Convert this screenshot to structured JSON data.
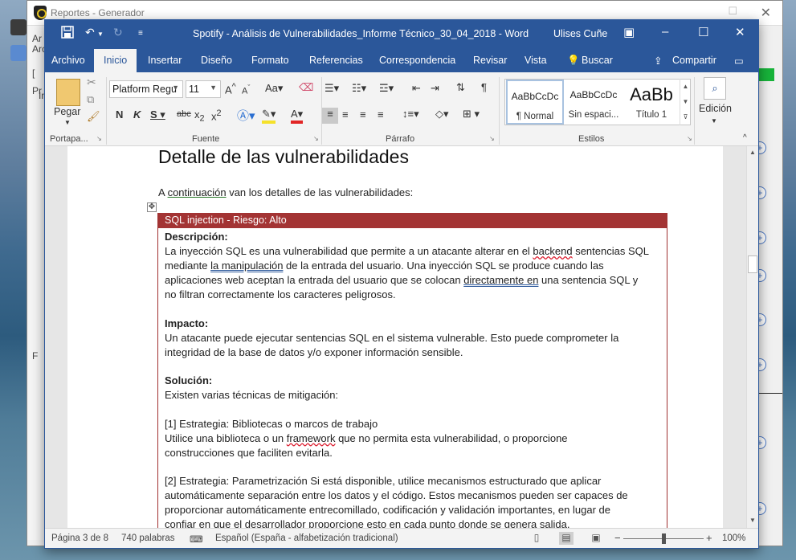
{
  "bg_window": {
    "title": "Reportes - Generador",
    "side_fragments": [
      "Ar",
      "Arc",
      "[",
      "Pr",
      "In",
      "F"
    ]
  },
  "word": {
    "title": "Spotify - Análisis de Vulnerabilidades_Informe Técnico_30_04_2018  -  Word",
    "user": "Ulises Cuñe",
    "tabs": [
      "Archivo",
      "Inicio",
      "Insertar",
      "Diseño",
      "Formato",
      "Referencias",
      "Correspondencia",
      "Revisar",
      "Vista",
      "Buscar",
      "Compartir"
    ],
    "ribbon": {
      "paste_label": "Pegar",
      "font_name": "Platform Regu",
      "font_size": "11",
      "styles": [
        {
          "preview": "AaBbCcDc",
          "name": "¶ Normal"
        },
        {
          "preview": "AaBbCcDc",
          "name": "Sin espaci..."
        },
        {
          "preview": "AaBb",
          "name": "Título 1"
        }
      ],
      "editing_label": "Edición",
      "groups": {
        "clipboard": "Portapa...",
        "font": "Fuente",
        "paragraph": "Párrafo",
        "styles": "Estilos"
      }
    },
    "document": {
      "heading": "Detalle de las vulnerabilidades",
      "intro": {
        "prefix": "A ",
        "link": "continuación",
        "suffix": " van los detalles de las vulnerabilidades:"
      },
      "table_header": "SQL injection - Riesgo: Alto",
      "description_label": "Descripción:",
      "description_lines": [
        {
          "a": "La inyección SQL es una vulnerabilidad que permite a un atacante alterar en el ",
          "b": "backend",
          "c": " sentencias SQL"
        },
        {
          "a": "mediante ",
          "b": "la  manipulación",
          "c": " de la entrada del usuario. Una inyección SQL se produce cuando las"
        },
        {
          "a": "aplicaciones web aceptan la entrada del usuario que se colocan ",
          "b": "directamente  en",
          "c": " una sentencia SQL y"
        },
        {
          "a": "no filtran correctamente los caracteres peligrosos.",
          "b": "",
          "c": ""
        }
      ],
      "impact_label": "Impacto:",
      "impact_lines": [
        "Un atacante puede ejecutar sentencias SQL en el sistema vulnerable. Esto puede comprometer la",
        "integridad de la base de datos y/o exponer información sensible."
      ],
      "solution_label": "Solución:",
      "solution_intro": "Existen varias técnicas de mitigación:",
      "strategy1_title": "[1] Estrategia: Bibliotecas o marcos de trabajo",
      "strategy1_line1": {
        "a": "Utilice una biblioteca o un ",
        "b": "framework",
        "c": " que no permita esta vulnerabilidad, o proporcione"
      },
      "strategy1_line2": "construcciones que faciliten evitarla.",
      "strategy2_lines": [
        "[2] Estrategia: Parametrización Si está disponible, utilice mecanismos estructurado que aplicar",
        "automáticamente separación entre los datos y el código. Estos mecanismos pueden ser capaces de",
        "proporcionar automáticamente entrecomillado, codificación y validación importantes, en lugar de",
        "confiar en que el desarrollador proporcione esto en cada punto donde se genera salida."
      ]
    },
    "status": {
      "page": "Página 3 de 8",
      "words": "740 palabras",
      "language": "Español (España - alfabetización tradicional)",
      "zoom": "100%"
    }
  },
  "colors": {
    "word_blue": "#2b579a",
    "table_header": "#a33434"
  }
}
